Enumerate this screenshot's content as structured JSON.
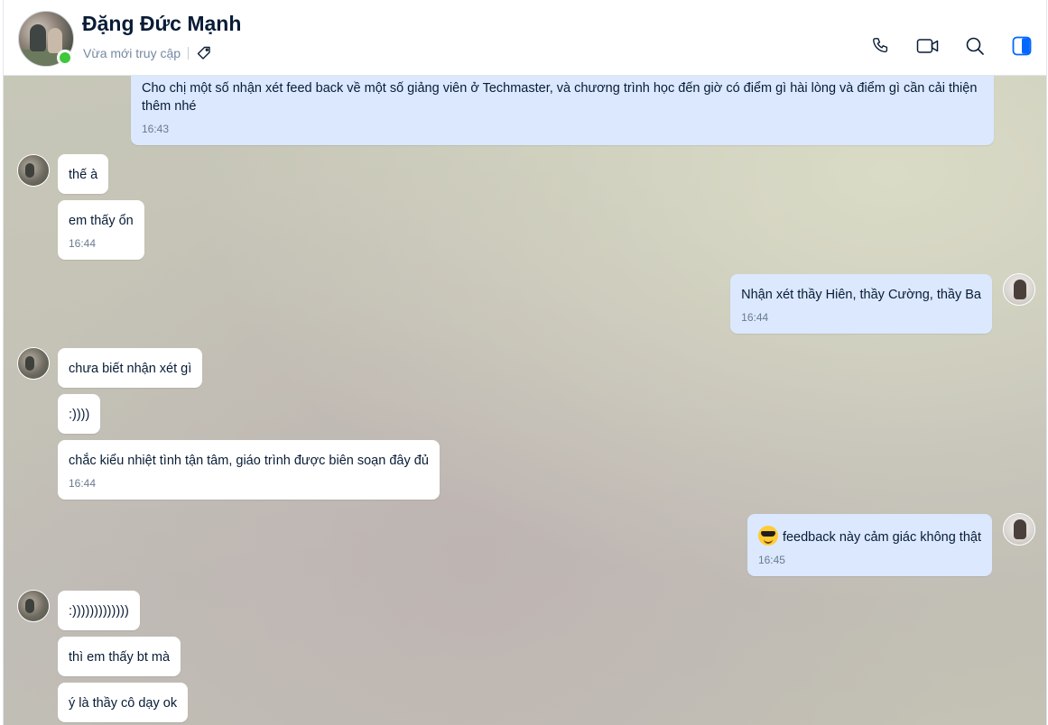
{
  "header": {
    "contact_name": "Đặng Đức Mạnh",
    "status": "Vừa mới truy cập",
    "icons": [
      "phone-icon",
      "video-call-icon",
      "search-icon",
      "sidebar-toggle-icon"
    ],
    "accent_color": "#0068ff",
    "online_color": "#3ec83a"
  },
  "messages": [
    {
      "side": "out",
      "text": "Cho chị một số nhận xét feed back về một số giảng viên ở Techmaster, và chương trình học đến giờ có điểm gì hài lòng và điểm gì cần cải thiện thêm nhé",
      "time": "16:43"
    },
    {
      "side": "in",
      "text": "thế à"
    },
    {
      "side": "in",
      "text": "em thấy ổn",
      "time": "16:44"
    },
    {
      "side": "out",
      "text": "Nhận xét thầy Hiên, thầy Cường, thầy Ba",
      "time": "16:44"
    },
    {
      "side": "in",
      "text": "chưa biết nhận xét gì"
    },
    {
      "side": "in",
      "text": ":))))"
    },
    {
      "side": "in",
      "text": "chắc kiểu nhiệt tình tận tâm, giáo trình được biên soạn đây đủ",
      "time": "16:44"
    },
    {
      "side": "out",
      "text": "feedback này cảm giác không thật",
      "time": "16:45",
      "emoji": "sunglasses-emoji"
    },
    {
      "side": "in",
      "text": ":)))))))))))))"
    },
    {
      "side": "in",
      "text": "thì em thấy bt mà"
    },
    {
      "side": "in",
      "text": "ý là thầy cô dạy ok"
    }
  ]
}
